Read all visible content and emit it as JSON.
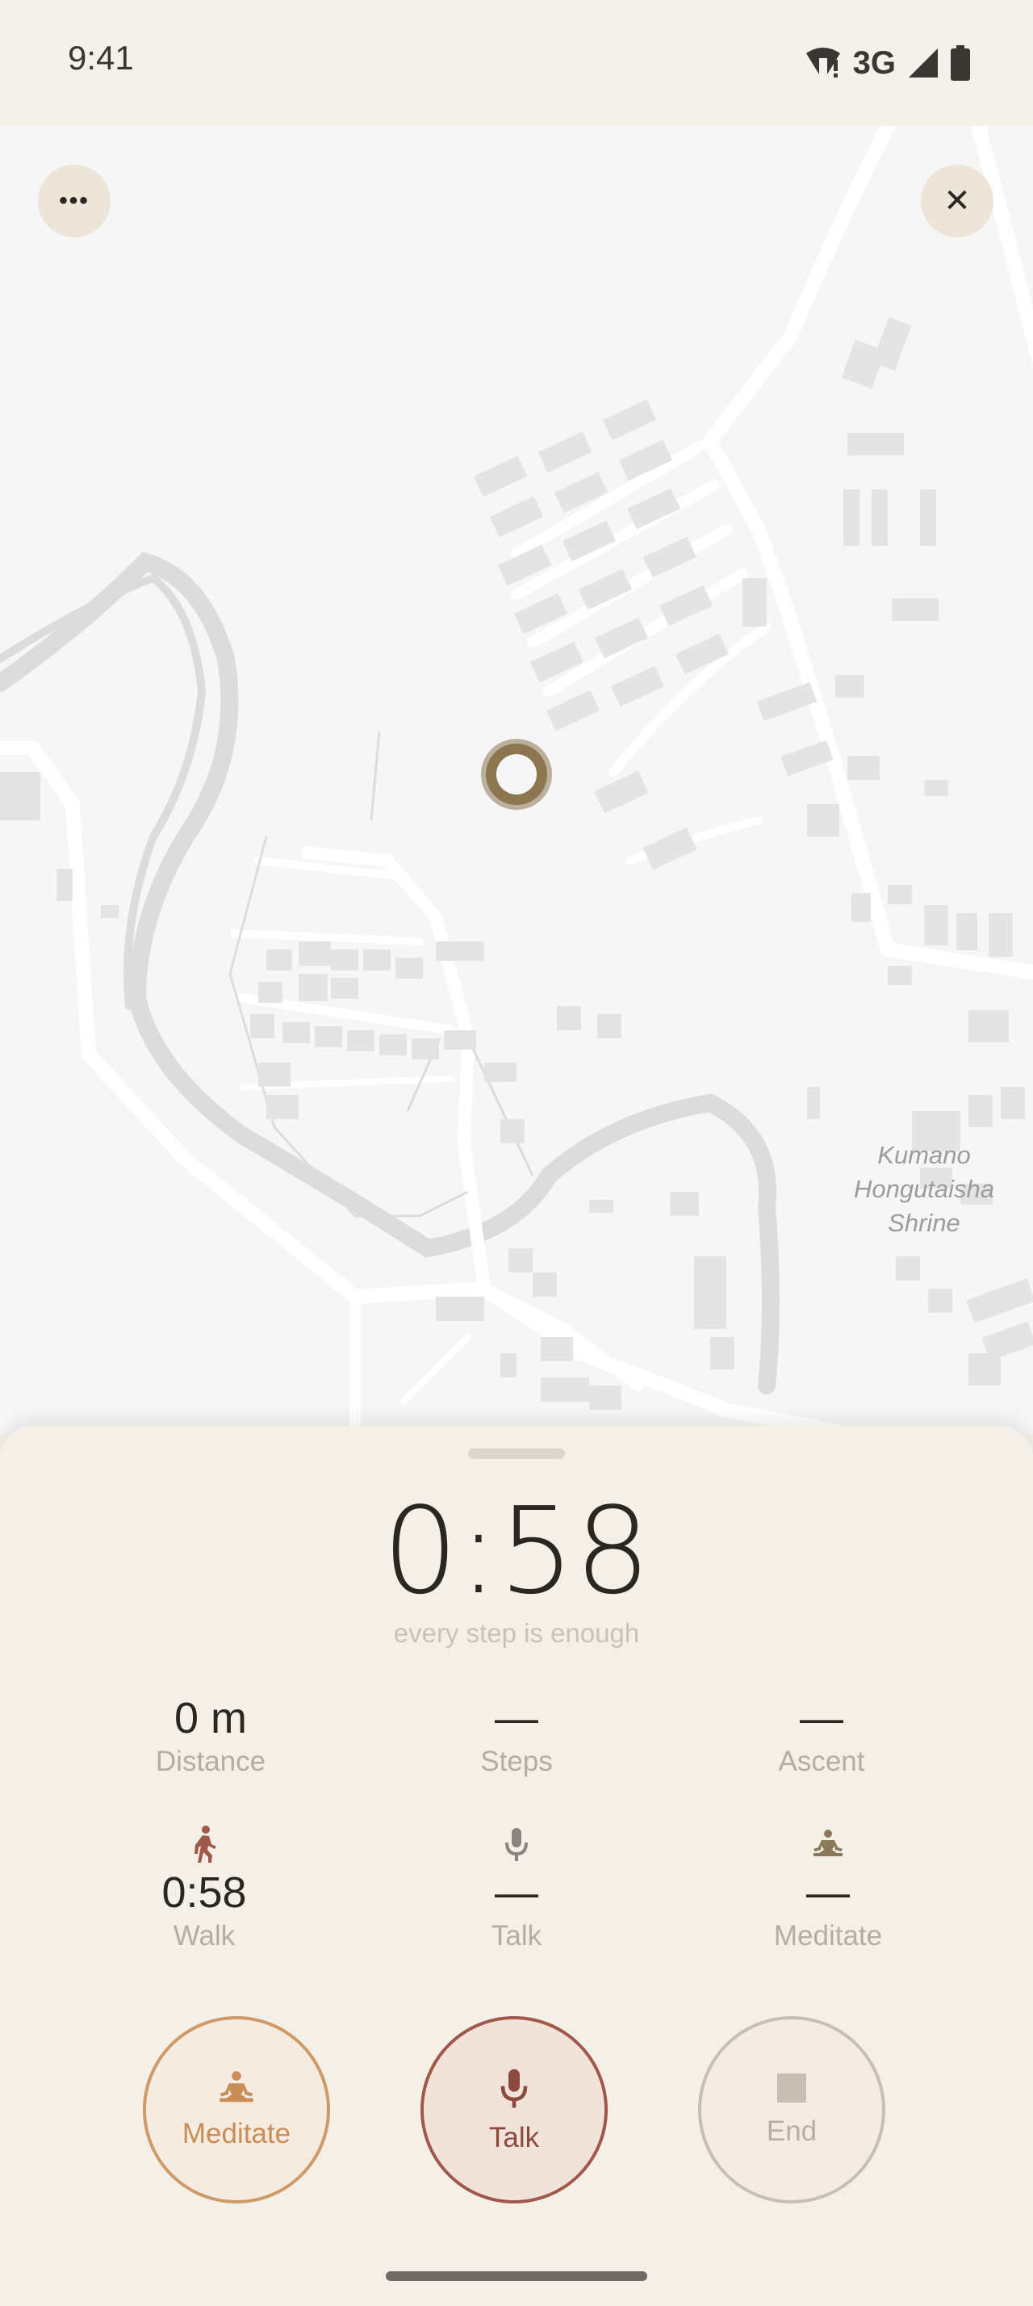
{
  "status_bar": {
    "time": "9:41",
    "network": "3G",
    "icons": [
      "wifi-alert-icon",
      "signal-icon",
      "battery-icon"
    ]
  },
  "map": {
    "place_label": "Kumano Hongutaisha Shrine",
    "more_icon": "•••",
    "close_icon": "✕",
    "marker_color": "#8b7650"
  },
  "session": {
    "timer": "0:58",
    "tagline": "every step is enough"
  },
  "stats_top": [
    {
      "value": "0 m",
      "label": "Distance"
    },
    {
      "value": "—",
      "label": "Steps"
    },
    {
      "value": "—",
      "label": "Ascent"
    }
  ],
  "stats_modes": [
    {
      "icon": "walk-icon",
      "value": "0:58",
      "label": "Walk",
      "color": "#a0584a"
    },
    {
      "icon": "mic-icon",
      "value": "—",
      "label": "Talk",
      "color": "#8a8480"
    },
    {
      "icon": "meditate-icon",
      "value": "—",
      "label": "Meditate",
      "color": "#8a7a5a"
    }
  ],
  "actions": {
    "meditate": "Meditate",
    "talk": "Talk",
    "end": "End"
  },
  "colors": {
    "background": "#f4f1ea",
    "text_primary": "#2b2622",
    "text_muted": "#b5ada3",
    "meditate_accent": "#cf9a68",
    "talk_accent": "#a0584a"
  }
}
